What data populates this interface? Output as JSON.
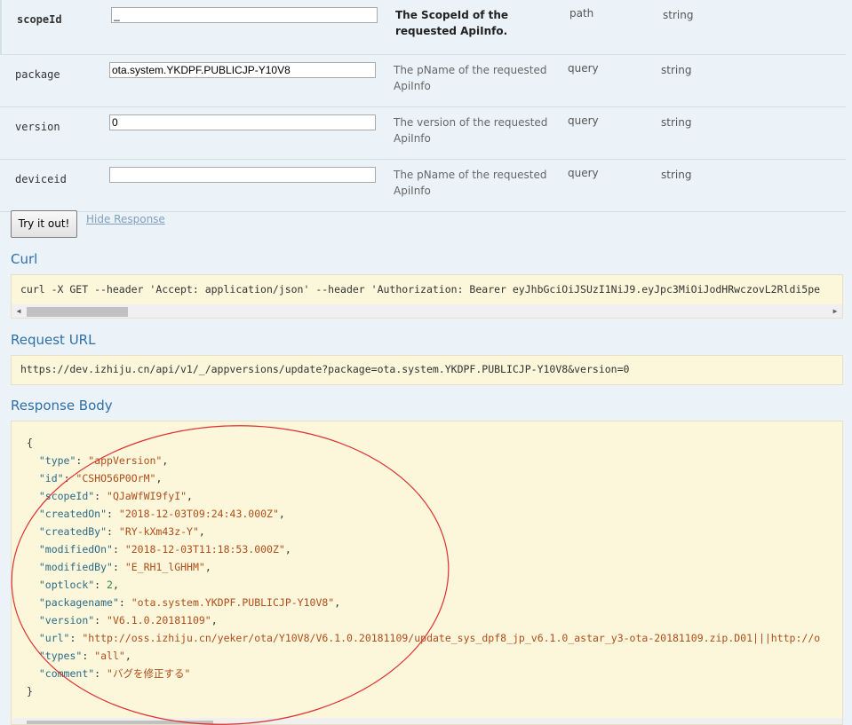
{
  "params": [
    {
      "name": "scopeId",
      "value": "_",
      "description": "The ScopeId of the requested ApiInfo.",
      "param_type": "path",
      "data_type": "string",
      "required": true
    },
    {
      "name": "package",
      "value": "ota.system.YKDPF.PUBLICJP-Y10V8",
      "description": "The pName of the requested ApiInfo",
      "param_type": "query",
      "data_type": "string",
      "required": false
    },
    {
      "name": "version",
      "value": "0",
      "description": "The version of the requested ApiInfo",
      "param_type": "query",
      "data_type": "string",
      "required": false
    },
    {
      "name": "deviceid",
      "value": "",
      "description": "The pName of the requested ApiInfo",
      "param_type": "query",
      "data_type": "string",
      "required": false
    }
  ],
  "actions": {
    "try_label": "Try it out!",
    "hide_response_label": "Hide Response"
  },
  "sections": {
    "curl_title": "Curl",
    "request_url_title": "Request URL",
    "response_body_title": "Response Body"
  },
  "curl_command": "curl -X GET --header 'Accept: application/json' --header 'Authorization: Bearer eyJhbGciOiJSUzI1NiJ9.eyJpc3MiOiJodHRwczovL2Rldi5pe",
  "request_url": "https://dev.izhiju.cn/api/v1/_/appversions/update?package=ota.system.YKDPF.PUBLICJP-Y10V8&version=0",
  "response_body": {
    "open": "{",
    "close": "}",
    "fields": [
      {
        "key": "type",
        "value": "appVersion",
        "kind": "string"
      },
      {
        "key": "id",
        "value": "CSHO56P0OrM",
        "kind": "string"
      },
      {
        "key": "scopeId",
        "value": "QJaWfWI9fyI",
        "kind": "string"
      },
      {
        "key": "createdOn",
        "value": "2018-12-03T09:24:43.000Z",
        "kind": "string"
      },
      {
        "key": "createdBy",
        "value": "RY-kXm43z-Y",
        "kind": "string"
      },
      {
        "key": "modifiedOn",
        "value": "2018-12-03T11:18:53.000Z",
        "kind": "string"
      },
      {
        "key": "modifiedBy",
        "value": "E_RH1_lGHHM",
        "kind": "string"
      },
      {
        "key": "optlock",
        "value": "2",
        "kind": "number"
      },
      {
        "key": "packagename",
        "value": "ota.system.YKDPF.PUBLICJP-Y10V8",
        "kind": "string"
      },
      {
        "key": "version",
        "value": "V6.1.0.20181109",
        "kind": "string"
      },
      {
        "key": "url",
        "value": "http://oss.izhiju.cn/yeker/ota/Y10V8/V6.1.0.20181109/update_sys_dpf8_jp_v6.1.0_astar_y3-ota-20181109.zip.D01|||http://o",
        "kind": "string-truncated"
      },
      {
        "key": "types",
        "value": "all",
        "kind": "string"
      },
      {
        "key": "comment",
        "value": "バグを修正する",
        "kind": "string-last"
      }
    ]
  },
  "colors": {
    "page_bg": "#ebf3f9",
    "code_bg": "#fcf6db",
    "title_blue": "#2d6fa8",
    "annotation_red": "#e03030"
  }
}
